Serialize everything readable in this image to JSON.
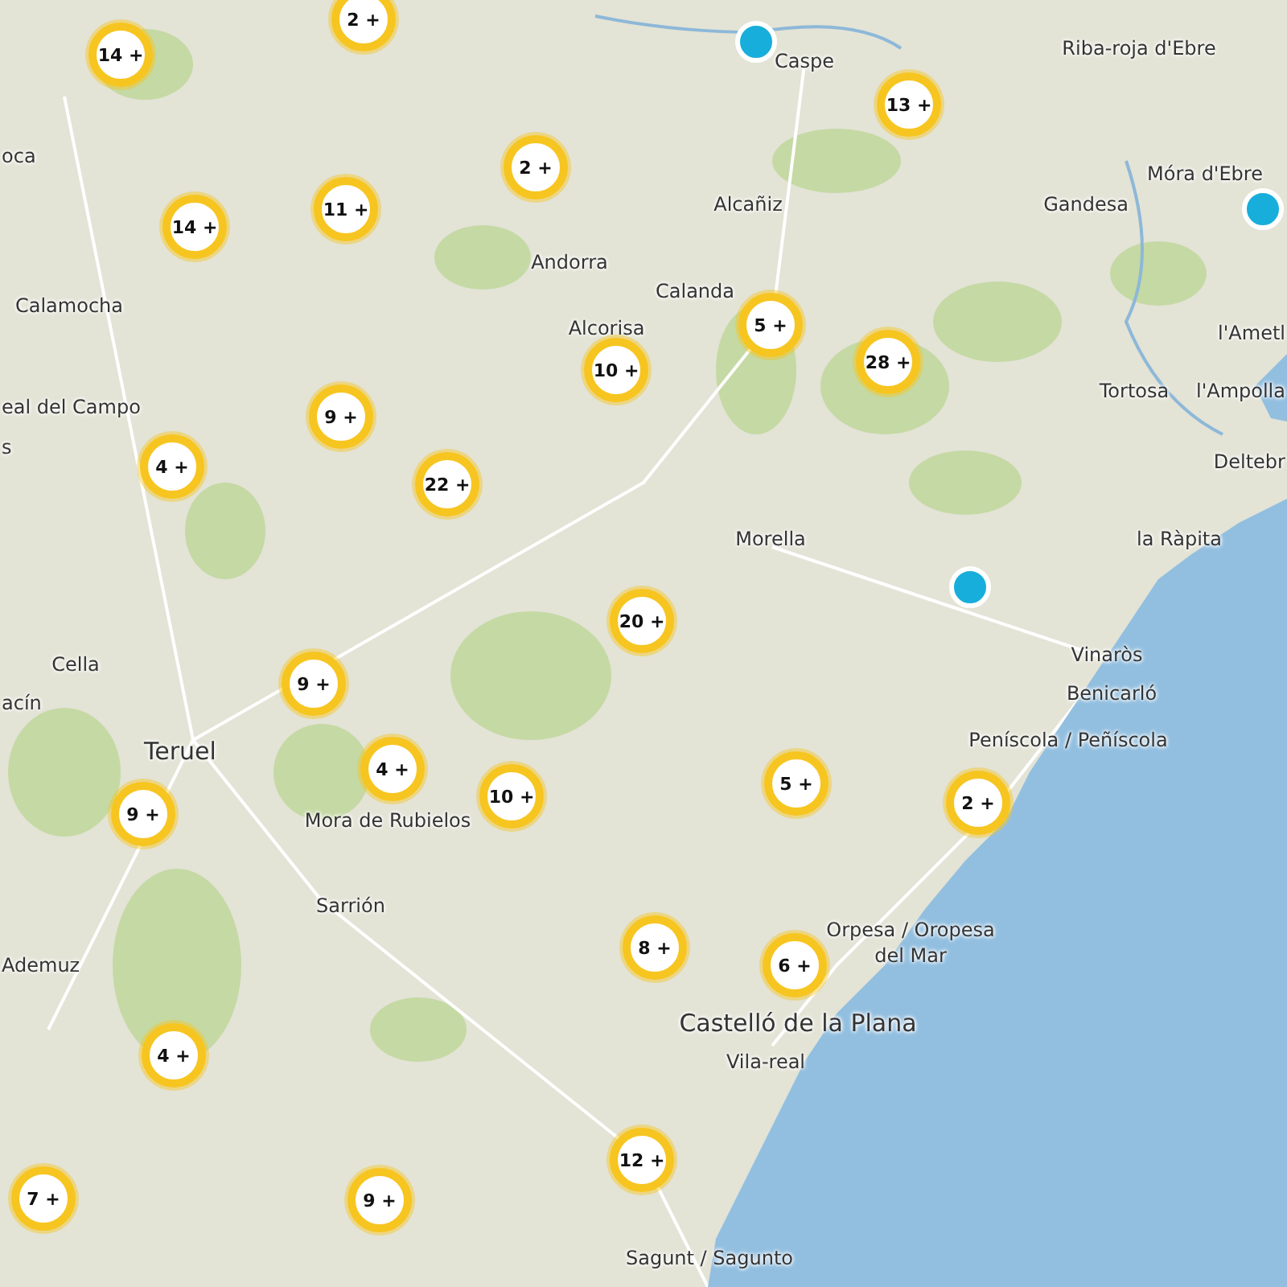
{
  "places": [
    "Caspe",
    "Riba-roja d'Ebre",
    "Móra d'Ebre",
    "Gandesa",
    "Alcañiz",
    "Andorra",
    "Calanda",
    "Alcorisa",
    "oca",
    "Calamocha",
    "eal del Campo",
    "s",
    "l'Ametl",
    "Tortosa",
    "l'Ampolla",
    "Deltebr",
    "la Ràpita",
    "Morella",
    "Vinaròs",
    "Benicarló",
    "Peníscola / Peñíscola",
    "Cella",
    "acín",
    "Teruel",
    "Mora de Rubielos",
    "Sarrión",
    "Ademuz",
    "Orpesa / Oropesa",
    "del Mar",
    "Castelló de la Plana",
    "Vila-real",
    "Sagunt / Sagunto"
  ],
  "clusters": [
    "14 +",
    "2 +",
    "13 +",
    "2 +",
    "11 +",
    "14 +",
    "5 +",
    "28 +",
    "10 +",
    "9 +",
    "4 +",
    "22 +",
    "20 +",
    "9 +",
    "4 +",
    "10 +",
    "9 +",
    "5 +",
    "2 +",
    "8 +",
    "6 +",
    "4 +",
    "12 +",
    "7 +",
    "9 +"
  ],
  "points": [
    {
      "kind": "dot"
    },
    {
      "kind": "dot"
    },
    {
      "kind": "dot"
    }
  ]
}
